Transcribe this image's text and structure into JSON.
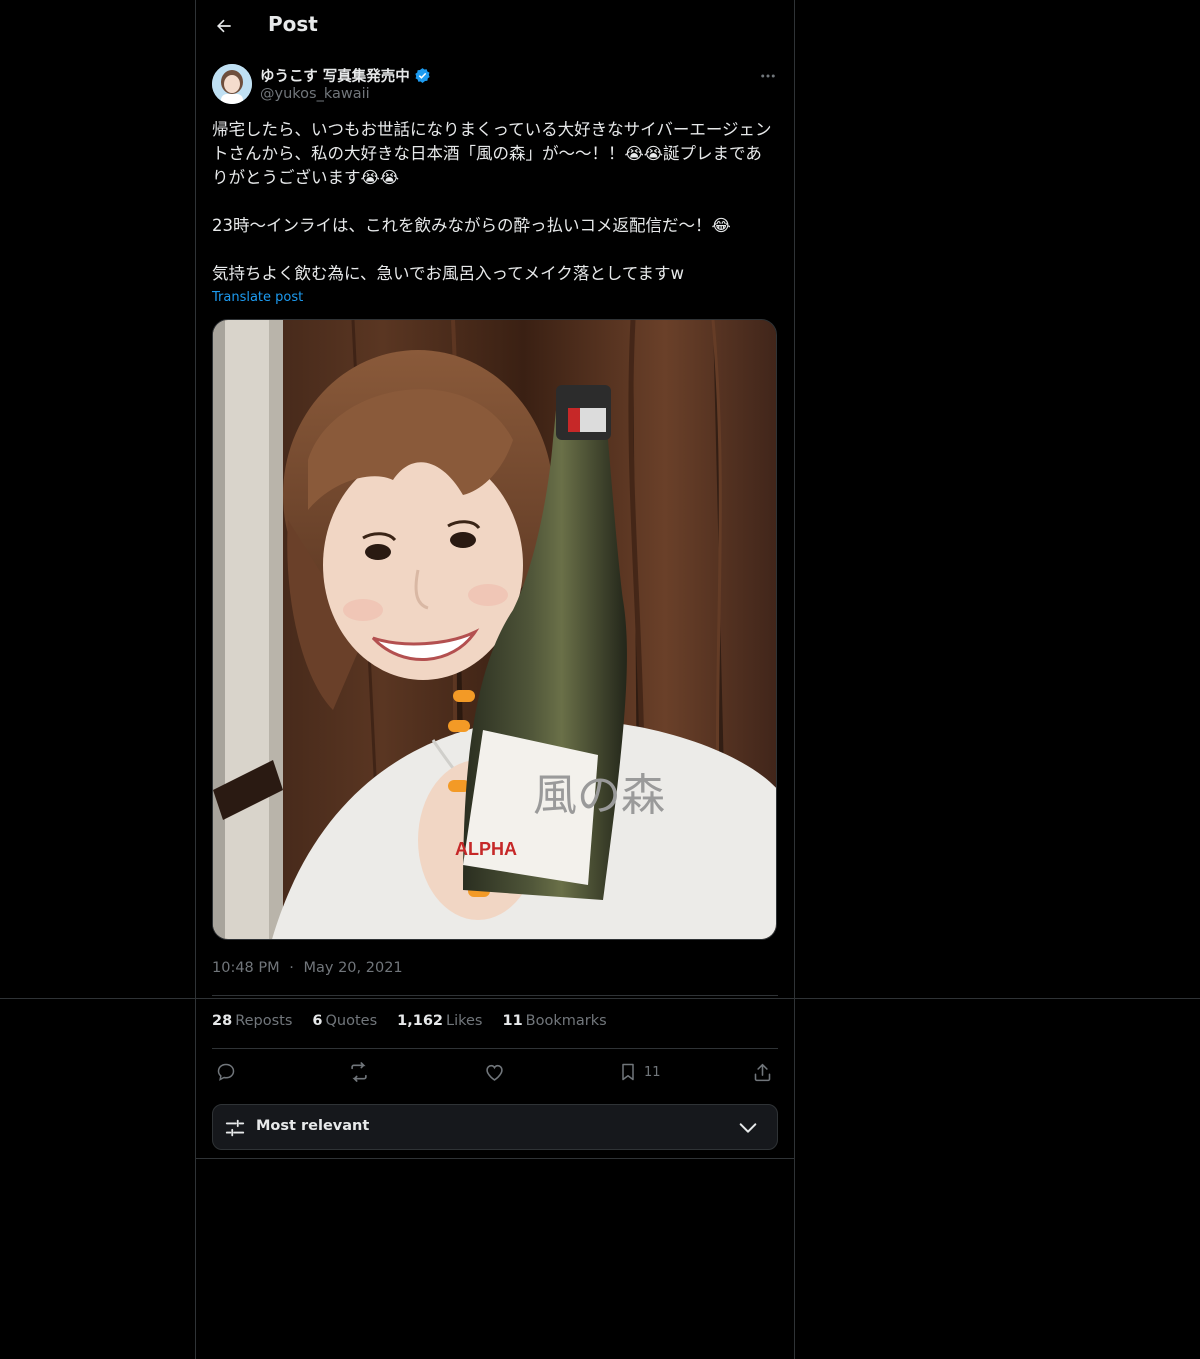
{
  "header": {
    "title": "Post"
  },
  "author": {
    "display_name": "ゆうこす 写真集発売中",
    "handle": "@yukos_kawaii",
    "verified": true
  },
  "post": {
    "text": "帰宅したら、いつもお世話になりまくっている大好きなサイバーエージェントさんから、私の大好きな日本酒「風の森」が〜〜！！😭😭誕プレまでありがとうございます😭😭\n\n23時〜インライは、これを飲みながらの酔っ払いコメ返配信だ〜！😂\n\n気持ちよく飲む為に、急いでお風呂入ってメイク落としてますw",
    "translate_label": "Translate post",
    "time": "10:48 PM",
    "date": "May 20, 2021",
    "dot": "·",
    "bottle_label_text": "風の森",
    "bottle_label_brand": "ALPHA"
  },
  "stats": {
    "reposts": {
      "count": "28",
      "label": "Reposts"
    },
    "quotes": {
      "count": "6",
      "label": "Quotes"
    },
    "likes": {
      "count": "1,162",
      "label": "Likes"
    },
    "bookmarks": {
      "count": "11",
      "label": "Bookmarks"
    }
  },
  "actions": {
    "reply": "reply-icon",
    "repost": "repost-icon",
    "like": "heart-icon",
    "bookmark_count": "11",
    "share": "share-icon"
  },
  "sort": {
    "label": "Most relevant"
  },
  "colors": {
    "background": "#000000",
    "text": "#e7e9ea",
    "muted": "#71767b",
    "border": "#2f3336",
    "accent": "#1d9bf0",
    "verified": "#1d9bf0"
  }
}
